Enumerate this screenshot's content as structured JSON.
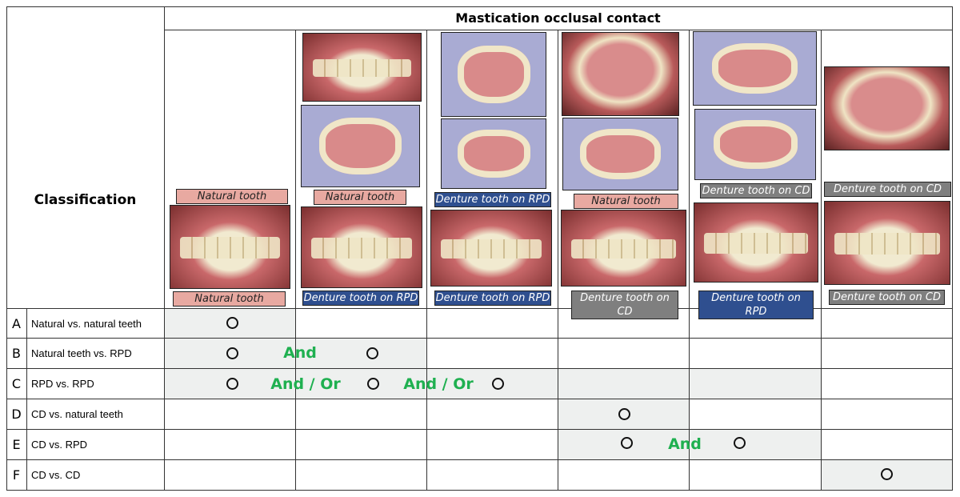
{
  "header": {
    "title": "Mastication occlusal contact",
    "classification": "Classification"
  },
  "labels": {
    "natural": "Natural tooth",
    "rpd": "Denture tooth on RPD",
    "cd": "Denture tooth on CD"
  },
  "colors": {
    "natural_label": "#e8a9a1",
    "rpd_label": "#2f4f8f",
    "cd_label": "#7f7f7f",
    "connector": "#1fb050",
    "shade": "#eef0ef"
  },
  "rows": [
    {
      "letter": "A",
      "label": "Natural vs. natural teeth",
      "connectors": []
    },
    {
      "letter": "B",
      "label": "Natural teeth vs. RPD",
      "connectors": [
        "And"
      ]
    },
    {
      "letter": "C",
      "label": "RPD vs. RPD",
      "connectors": [
        "And / Or",
        "And / Or"
      ]
    },
    {
      "letter": "D",
      "label": "CD vs. natural teeth",
      "connectors": []
    },
    {
      "letter": "E",
      "label": "CD vs. RPD",
      "connectors": [
        "And"
      ]
    },
    {
      "letter": "F",
      "label": "CD vs. CD",
      "connectors": []
    }
  ]
}
